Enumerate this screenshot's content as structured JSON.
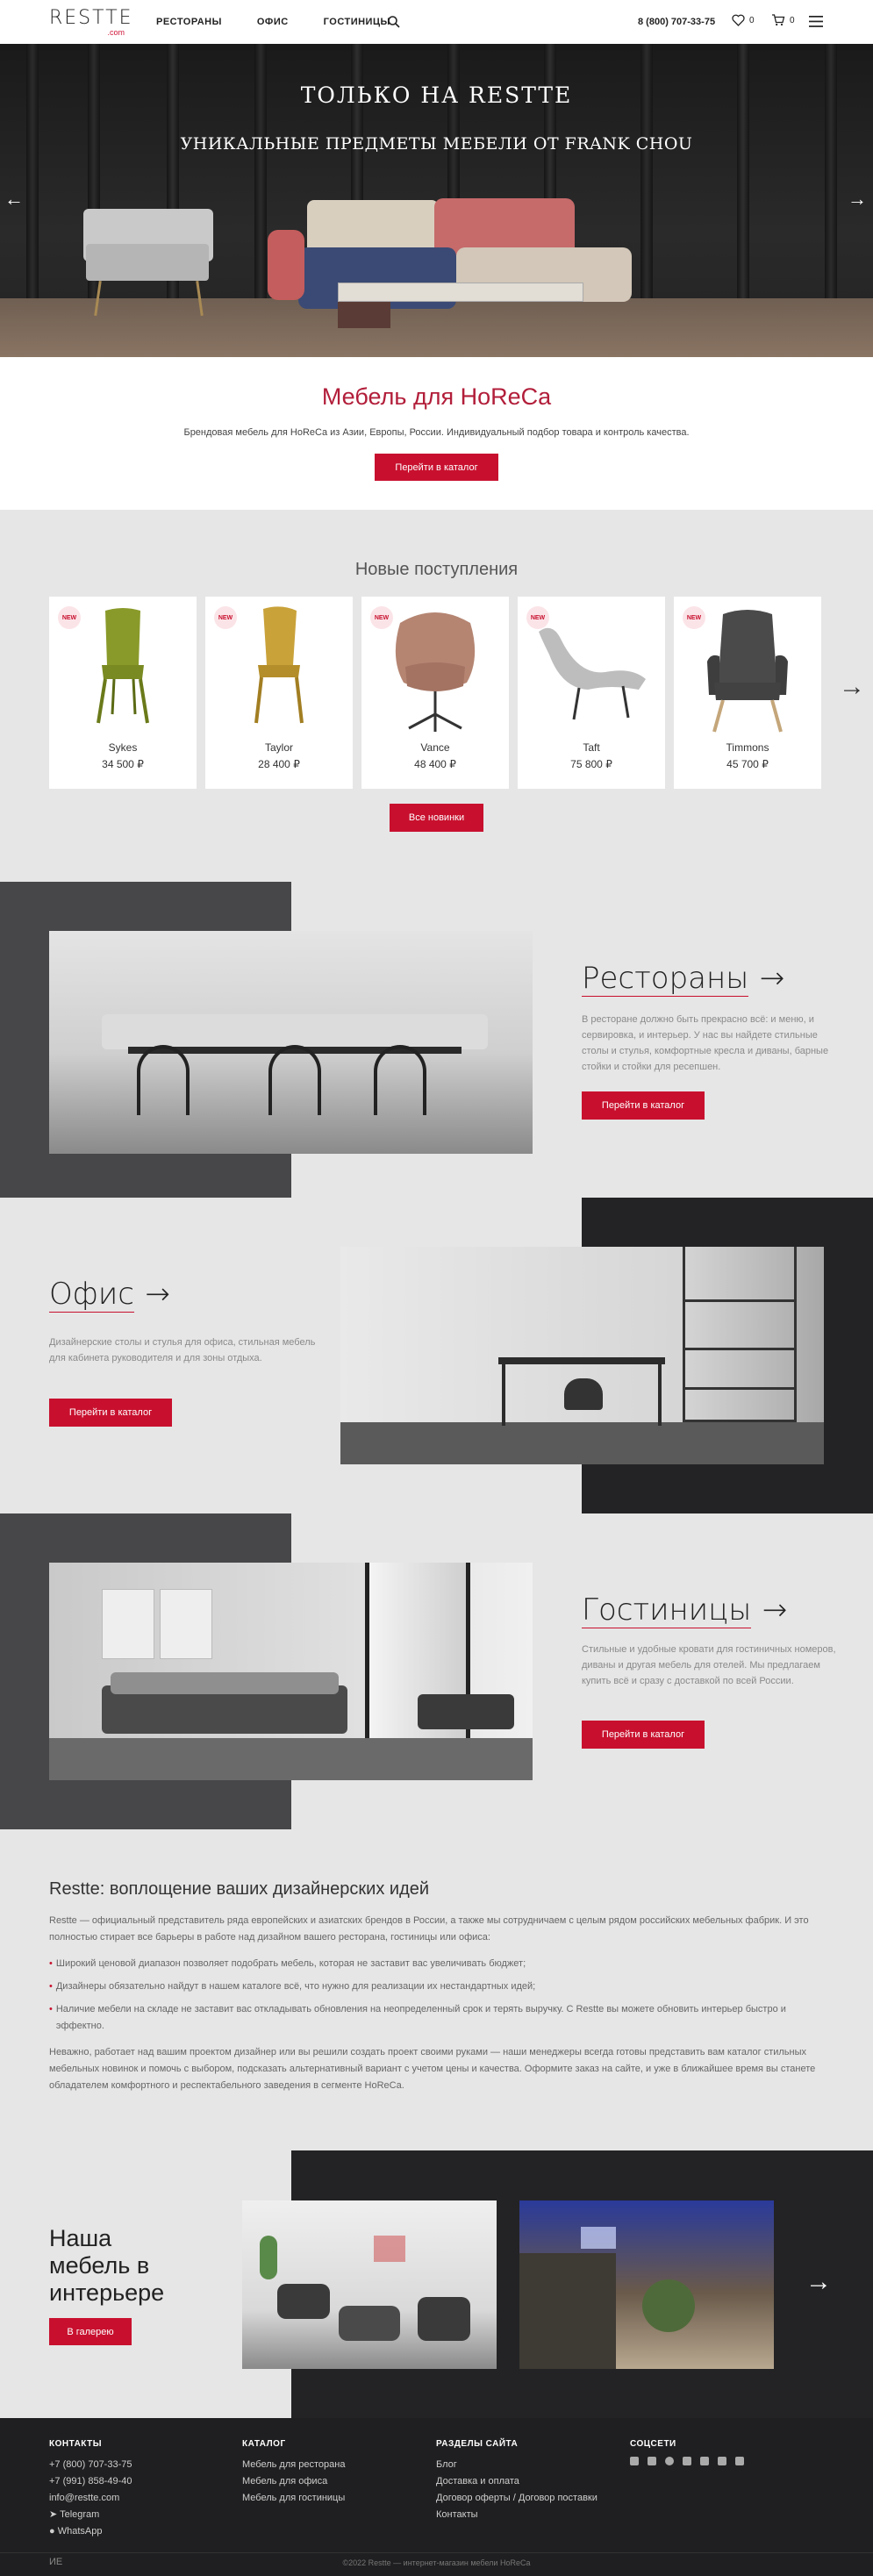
{
  "header": {
    "logo": "RESTTE",
    "logo_sub": ".com",
    "nav": [
      "РЕСТОРАНЫ",
      "ОФИС",
      "ГОСТИНИЦЫ"
    ],
    "phone": "8 (800) 707-33-75",
    "wishlist_count": "0",
    "cart_count": "0"
  },
  "hero": {
    "title": "ТОЛЬКО НА RESTTE",
    "subtitle": "УНИКАЛЬНЫЕ ПРЕДМЕТЫ МЕБЕЛИ ОТ FRANK CHOU",
    "prev": "←",
    "next": "→"
  },
  "intro": {
    "title": "Мебель для HoReCa",
    "text": "Брендовая мебель для HoReCa из Азии, Европы, России.  Индивидуальный подбор товара и контроль качества.",
    "button": "Перейти в каталог"
  },
  "new_arrivals": {
    "title": "Новые поступления",
    "badge": "NEW",
    "items": [
      {
        "name": "Sykes",
        "price": "34 500 ₽",
        "color": "#8a9a2a"
      },
      {
        "name": "Taylor",
        "price": "28 400 ₽",
        "color": "#c9a23a"
      },
      {
        "name": "Vance",
        "price": "48 400 ₽",
        "color": "#b58572"
      },
      {
        "name": "Taft",
        "price": "75 800 ₽",
        "color": "#bdbdbd"
      },
      {
        "name": "Timmons",
        "price": "45 700 ₽",
        "color": "#4a4a4a"
      }
    ],
    "button": "Все новинки",
    "next": "→"
  },
  "sections": {
    "restaurants": {
      "title": "Рестораны",
      "arrow": "→",
      "text": "В ресторане должно быть прекрасно всё: и меню, и сервировка, и интерьер. У нас вы найдете стильные столы и стулья, комфортные кресла и диваны, барные стойки и стойки для ресепшен.",
      "button": "Перейти в каталог"
    },
    "office": {
      "title": "Офис",
      "arrow": "→",
      "text": "Дизайнерские столы и стулья для офиса, стильная мебель для кабинета руководителя и для зоны отдыха.",
      "button": "Перейти в каталог"
    },
    "hotels": {
      "title": "Гостиницы",
      "arrow": "→",
      "text": "Стильные и удобные кровати для гостиничных номеров, диваны и другая мебель для отелей. Мы предлагаем купить всё и сразу с доставкой по всей России.",
      "button": "Перейти в каталог"
    }
  },
  "about": {
    "title": "Restte: воплощение ваших дизайнерских идей",
    "p1": "Restte — официальный представитель ряда европейских и азиатских брендов в России, а также мы сотрудничаем с целым рядом российских мебельных фабрик. И это полностью стирает все барьеры в работе над дизайном вашего ресторана, гостиницы или офиса:",
    "bullets": [
      "Широкий ценовой диапазон позволяет подобрать мебель, которая не заставит вас увеличивать бюджет;",
      "Дизайнеры обязательно найдут в нашем каталоге всё, что нужно для реализации их нестандартных идей;",
      "Наличие мебели на складе не заставит вас откладывать обновления на неопределенный срок и терять выручку. С Restte вы можете обновить интерьер быстро и эффектно."
    ],
    "p2": "Неважно, работает над вашим проектом дизайнер или вы решили создать проект своими руками — наши менеджеры всегда готовы представить вам каталог стильных мебельных новинок и помочь с выбором, подсказать альтернативный вариант с учетом цены и качества. Оформите заказ на сайте, и уже в ближайшее время вы станете обладателем комфортного и респектабельного заведения в сегменте HoReCa."
  },
  "gallery": {
    "title": "Наша мебель в интерьере",
    "button": "В галерею",
    "next": "→"
  },
  "footer": {
    "contacts_h": "КОНТАКТЫ",
    "contacts": [
      "+7 (800) 707-33-75",
      "+7 (991) 858-49-40",
      "info@restte.com",
      "Telegram",
      "WhatsApp"
    ],
    "catalog_h": "КАТАЛОГ",
    "catalog": [
      "Мебель для ресторана",
      "Мебель для офиса",
      "Мебель для гостиницы"
    ],
    "sections_h": "РАЗДЕЛЫ САЙТА",
    "sections": [
      "Блог",
      "Доставка и оплата",
      "Договор оферты / Договор поставки",
      "Контакты"
    ],
    "social_h": "СОЦСЕТИ",
    "copyright": "©2022 Restte — интернет-магазин мебели HoReCa",
    "dev": "ИЕ"
  }
}
